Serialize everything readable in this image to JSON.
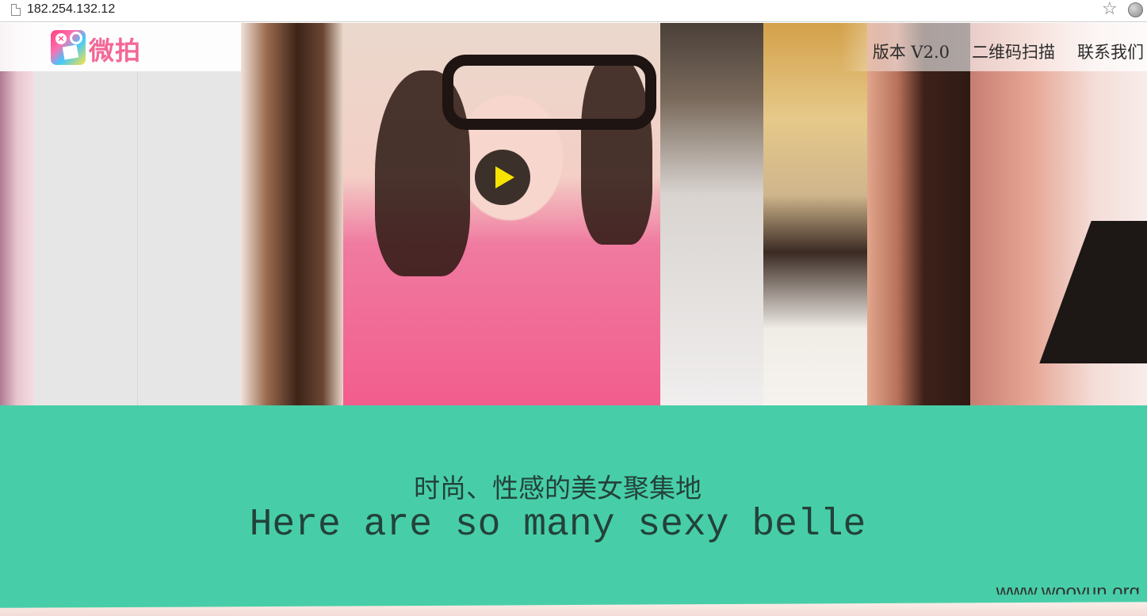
{
  "browser": {
    "url": "182.254.132.12",
    "icons": {
      "page": "page-icon",
      "bookmark": "star-icon",
      "menu": "globe-icon"
    }
  },
  "header": {
    "logo_text": "微拍",
    "logo_icon": "app-logo-icon",
    "nav": [
      {
        "label": "版本 V2.0"
      },
      {
        "label": "二维码扫描"
      },
      {
        "label": "联系我们"
      }
    ]
  },
  "hero": {
    "play_icon": "play-icon",
    "colors": {
      "play_bg": "#28201a",
      "play_arrow": "#f6e400"
    }
  },
  "slogan": {
    "chinese": "时尚、性感的美女聚集地",
    "english": "Here are so many sexy belle",
    "watermark": "www.wooyun.org",
    "bg_color": "#47cea8"
  }
}
